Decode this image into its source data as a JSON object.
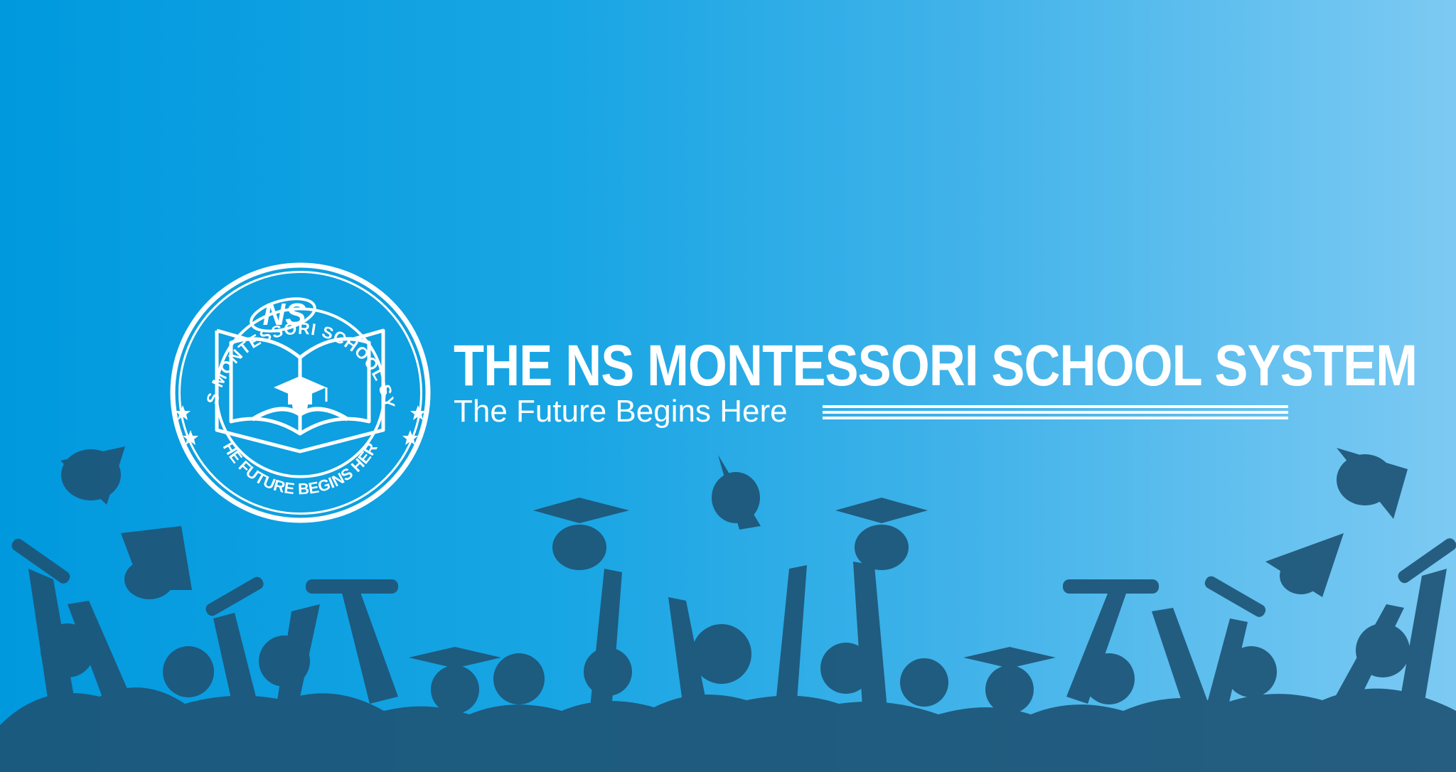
{
  "school": {
    "name": "THE NS MONTESSORI SCHOOL SYSTEM",
    "tagline": "The Future Begins Here"
  },
  "logo": {
    "monogram": "NS",
    "ring_top_text": "THE NS MONTESSORI SCHOOL SYSTEM",
    "ring_bottom_text": "THE FUTURE BEGINS HERE",
    "icon": "open-book-graduation-cap-icon"
  },
  "colors": {
    "background_left": "#0099de",
    "background_right": "#7ccaf3",
    "silhouette": "#1e5577",
    "text": "#ffffff"
  }
}
